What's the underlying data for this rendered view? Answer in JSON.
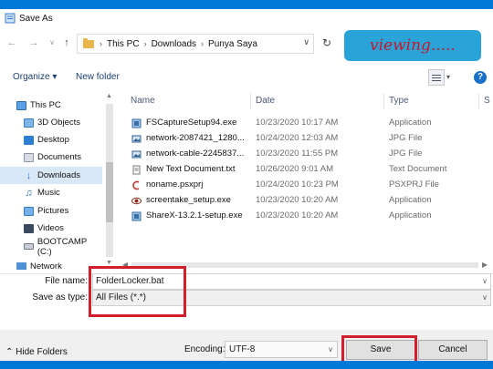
{
  "window": {
    "title": "Save As"
  },
  "address": {
    "crumbs": [
      "This PC",
      "Downloads",
      "Punya Saya"
    ]
  },
  "badge": {
    "text": "viewing....."
  },
  "toolbar": {
    "organize": "Organize ▾",
    "new_folder": "New folder",
    "help": "?"
  },
  "nav": {
    "items": [
      {
        "label": "This PC",
        "icon": "computer-icon"
      },
      {
        "label": "3D Objects",
        "icon": "cube-icon"
      },
      {
        "label": "Desktop",
        "icon": "desktop-icon"
      },
      {
        "label": "Documents",
        "icon": "documents-icon"
      },
      {
        "label": "Downloads",
        "icon": "download-arrow-icon",
        "selected": true
      },
      {
        "label": "Music",
        "icon": "music-note-icon"
      },
      {
        "label": "Pictures",
        "icon": "pictures-icon"
      },
      {
        "label": "Videos",
        "icon": "film-icon"
      },
      {
        "label": "BOOTCAMP (C:)",
        "icon": "drive-icon"
      },
      {
        "label": "Network",
        "icon": "network-icon"
      }
    ]
  },
  "files": {
    "columns": {
      "name": "Name",
      "date": "Date",
      "type": "Type",
      "size": "S"
    },
    "rows": [
      {
        "name": "FSCaptureSetup94.exe",
        "date": "10/23/2020 10:17 AM",
        "type": "Application",
        "icon": "installer-icon"
      },
      {
        "name": "network-2087421_1280...",
        "date": "10/24/2020 12:03 AM",
        "type": "JPG File",
        "icon": "image-file-icon"
      },
      {
        "name": "network-cable-2245837...",
        "date": "10/23/2020 11:55 PM",
        "type": "JPG File",
        "icon": "image-file-icon"
      },
      {
        "name": "New Text Document.txt",
        "date": "10/26/2020 9:01 AM",
        "type": "Text Document",
        "icon": "text-file-icon"
      },
      {
        "name": "noname.psxprj",
        "date": "10/24/2020 10:23 PM",
        "type": "PSXPRJ File",
        "icon": "project-file-icon"
      },
      {
        "name": "screentake_setup.exe",
        "date": "10/23/2020 10:20 AM",
        "type": "Application",
        "icon": "eye-app-icon"
      },
      {
        "name": "ShareX-13.2.1-setup.exe",
        "date": "10/23/2020 10:20 AM",
        "type": "Application",
        "icon": "installer-icon"
      }
    ]
  },
  "form": {
    "file_name_label": "File name:",
    "file_name_value": "FolderLocker.bat",
    "save_as_type_label": "Save as type:",
    "save_as_type_value": "All Files  (*.*)"
  },
  "footer": {
    "hide_folders": "Hide Folders",
    "encoding_label": "Encoding:",
    "encoding_value": "UTF-8",
    "save": "Save",
    "cancel": "Cancel"
  },
  "colors": {
    "accent": "#0078d7",
    "highlight": "#d1202b",
    "badge": "#2aa4d8"
  }
}
